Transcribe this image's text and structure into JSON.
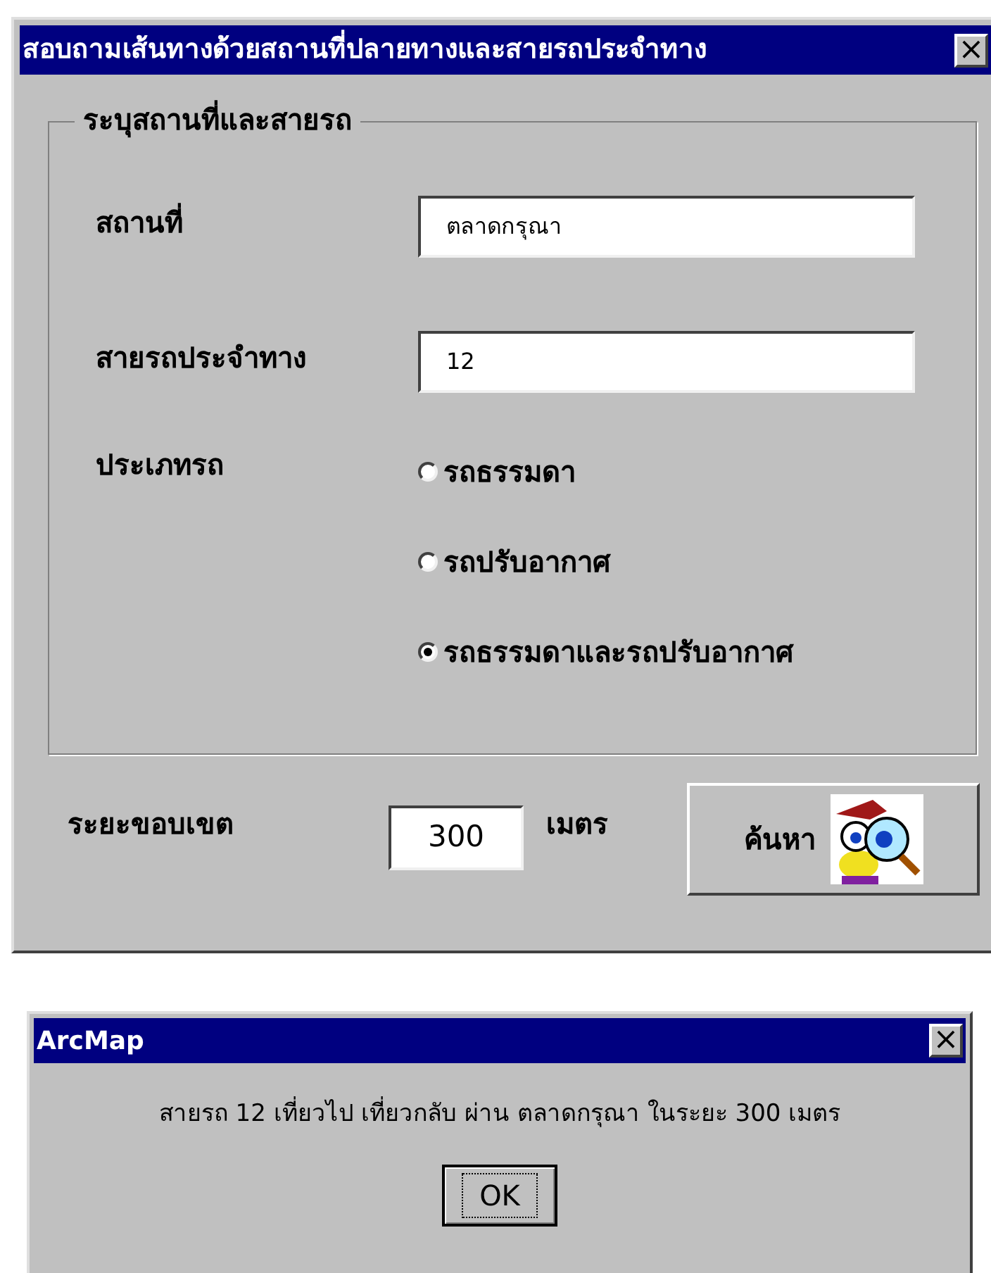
{
  "search_dialog": {
    "title": "สอบถามเส้นทางด้วยสถานที่ปลายทางและสายรถประจำทาง",
    "close": "×",
    "group": {
      "legend": "ระบุสถานที่และสายรถ",
      "fields": [
        {
          "label": "สถานที่",
          "value": "ตลาดกรุณา"
        },
        {
          "label": "สายรถประจำทาง",
          "value": "12"
        }
      ],
      "bus_type": {
        "label": "ประเภทรถ",
        "options": [
          {
            "label": "รถธรรมดา",
            "selected": false
          },
          {
            "label": "รถปรับอากาศ",
            "selected": false
          },
          {
            "label": "รถธรรมดาและรถปรับอากาศ",
            "selected": true
          }
        ]
      }
    },
    "radius": {
      "label": "ระยะขอบเขต",
      "value": "300",
      "unit": "เมตร"
    },
    "search_button": "ค้นหา"
  },
  "message_dialog": {
    "title": "ArcMap",
    "close": "×",
    "message": "สายรถ 12 เที่ยวไป เที่ยวกลับ ผ่าน ตลาดกรุณา ในระยะ 300 เมตร",
    "ok_button": "OK"
  }
}
